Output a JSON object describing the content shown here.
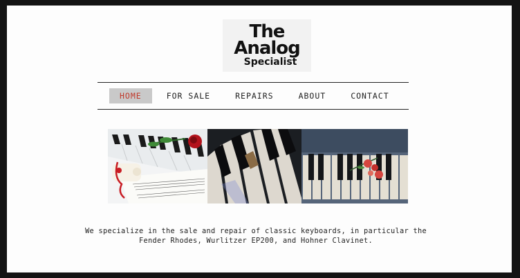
{
  "logo": {
    "line1": "The",
    "line2": "Analog",
    "line3": "Specialist"
  },
  "nav": {
    "items": [
      {
        "label": "HOME",
        "active": true
      },
      {
        "label": "FOR SALE",
        "active": false
      },
      {
        "label": "REPAIRS",
        "active": false
      },
      {
        "label": "ABOUT",
        "active": false
      },
      {
        "label": "CONTACT",
        "active": false
      }
    ]
  },
  "photos": [
    {
      "name": "piano-keys-roses-sheet-music-photo"
    },
    {
      "name": "piano-keys-closeup-photo"
    },
    {
      "name": "piano-keys-red-flowers-photo"
    }
  ],
  "intro": {
    "line1": "We specialize in the sale and repair of classic keyboards, in particular the",
    "line2": "Fender Rhodes, Wurlitzer EP200, and Hohner Clavinet."
  },
  "colors": {
    "active_nav_text": "#c0392b",
    "active_nav_bg": "#c9c9c9",
    "page_bg": "#141414"
  }
}
